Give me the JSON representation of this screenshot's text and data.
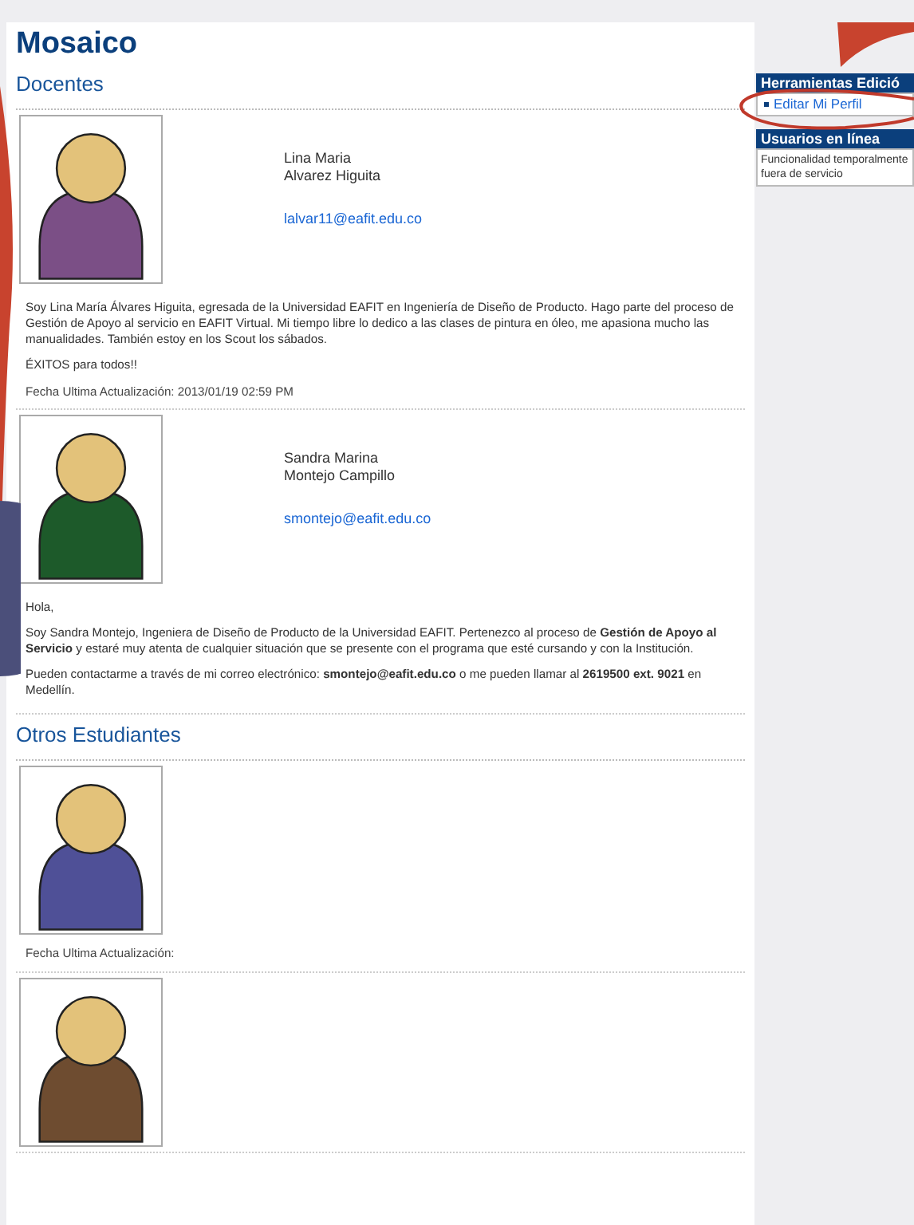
{
  "title": "Mosaico",
  "sections": [
    {
      "heading": "Docentes",
      "profiles": [
        {
          "color": "#7b4f86",
          "name_lines": [
            "Lina Maria",
            "Alvarez Higuita"
          ],
          "email": "lalvar11@eafit.edu.co",
          "bio": [
            "Soy Lina María Álvares Higuita, egresada de la Universidad EAFIT en Ingeniería de Diseño de Producto. Hago parte del proceso de Gestión de Apoyo al servicio en EAFIT Virtual. Mi tiempo libre lo dedico a las clases de pintura en óleo, me apasiona mucho las manualidades. También estoy en los Scout los sábados.",
            "ÉXITOS para todos!!"
          ],
          "updated": "Fecha Ultima Actualización: 2013/01/19 02:59 PM"
        },
        {
          "color": "#1d5a2a",
          "name_lines": [
            "Sandra Marina",
            "Montejo Campillo"
          ],
          "email": "smontejo@eafit.edu.co",
          "bio": [
            "Hola,",
            "Soy Sandra Montejo, Ingeniera de Diseño de Producto de la Universidad EAFIT. Pertenezco al proceso de **Gestión de Apoyo al Servicio** y estaré muy atenta de cualquier situación que se presente con el programa que esté cursando y con la Institución.",
            "Pueden contactarme a través de mi correo electrónico: **smontejo@eafit.edu.co** o me pueden llamar al **2619500 ext. 9021** en Medellín."
          ]
        }
      ]
    },
    {
      "heading": "Otros Estudiantes",
      "profiles": [
        {
          "color": "#4f5097",
          "updated": "Fecha Ultima Actualización:"
        },
        {
          "color": "#6e4c30"
        }
      ]
    }
  ],
  "sidebar": [
    {
      "title": "Herramientas Edició",
      "links": [
        "Editar Mi Perfil"
      ]
    },
    {
      "title": "Usuarios en línea",
      "text": "Funcionalidad temporalmente fuera de servicio"
    }
  ]
}
